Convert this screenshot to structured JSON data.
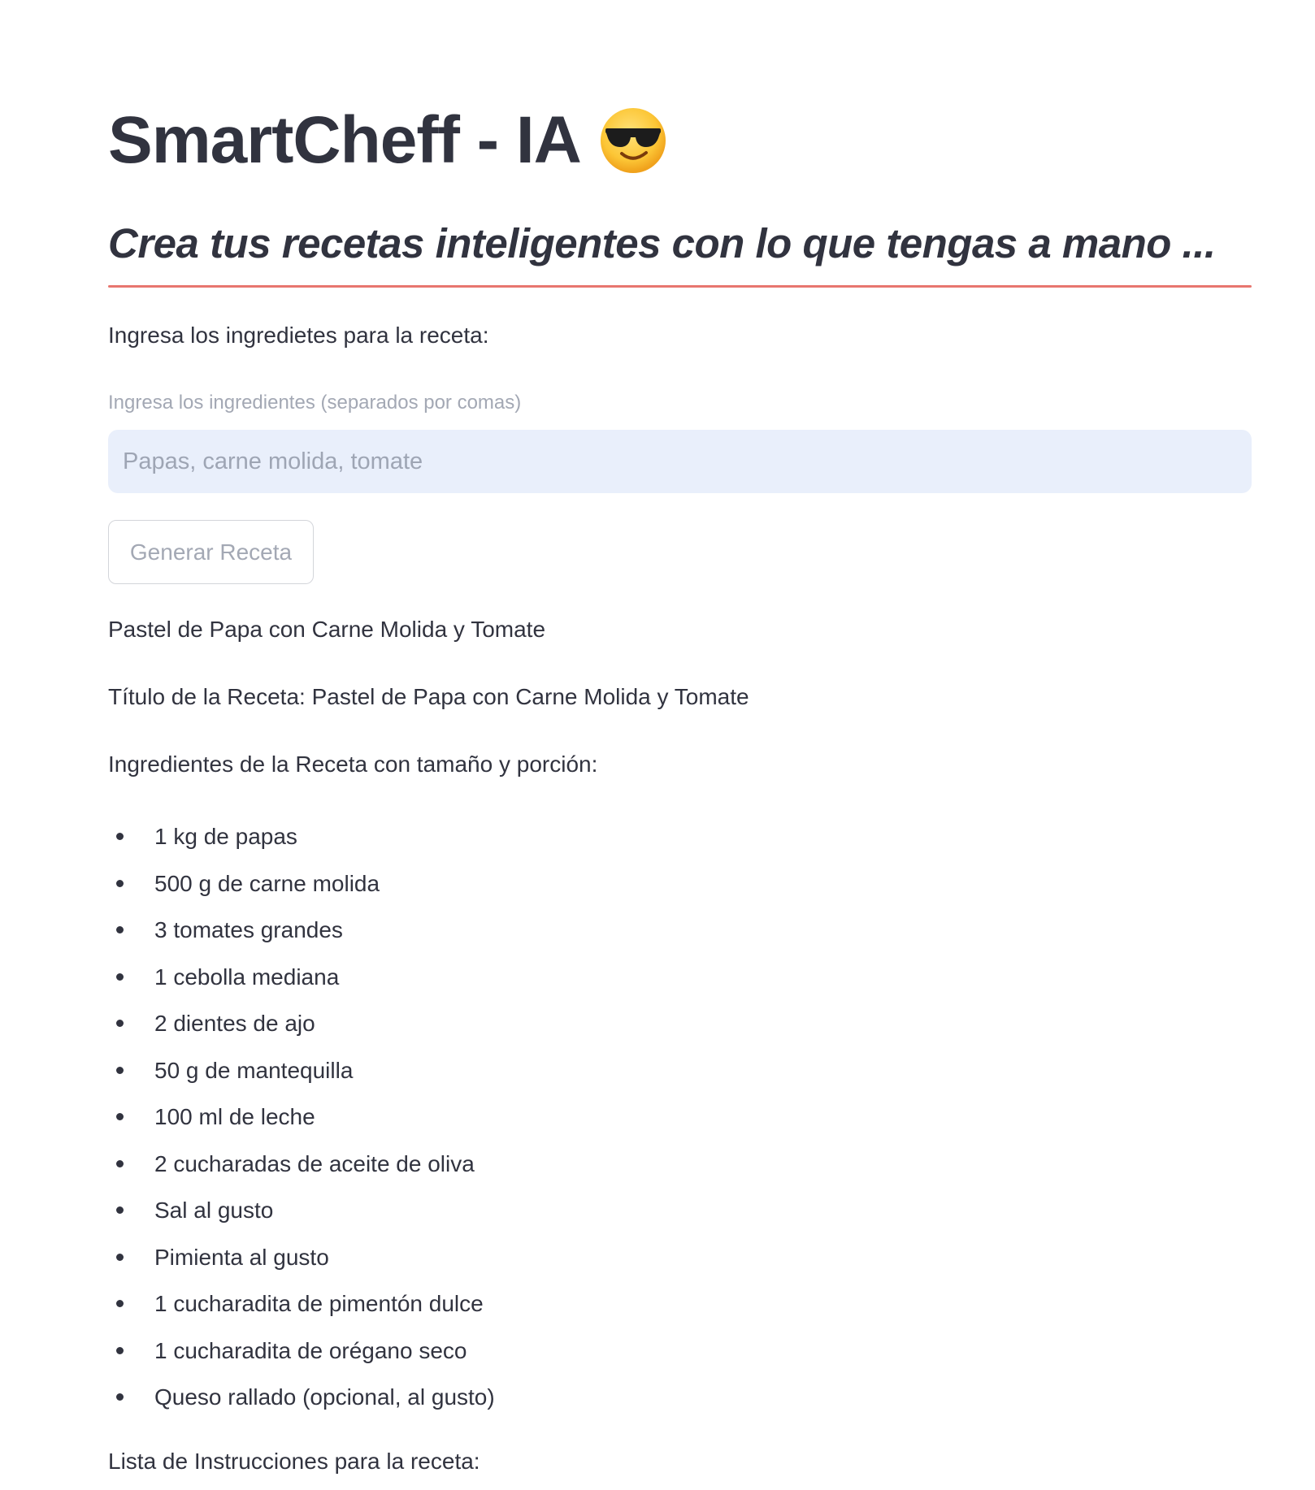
{
  "app": {
    "title": "SmartCheff - IA",
    "title_emoji": "smiling-face-with-sunglasses",
    "subheader": "Crea tus recetas inteligentes con lo que tengas a mano ...",
    "divider_color": "#e8766f"
  },
  "form": {
    "prompt_text": "Ingresa los ingredietes para la receta:",
    "input_label": "Ingresa los ingredientes (separados por comas)",
    "input_placeholder": "Papas, carne molida, tomate",
    "input_value": "",
    "generate_button": "Generar Receta"
  },
  "recipe": {
    "name": "Pastel de Papa con Carne Molida y Tomate",
    "title_line": "Título de la Receta: Pastel de Papa con Carne Molida y Tomate",
    "ingredients_heading": "Ingredientes de la Receta con tamaño y porción:",
    "ingredients": [
      "1 kg de papas",
      "500 g de carne molida",
      "3 tomates grandes",
      "1 cebolla mediana",
      "2 dientes de ajo",
      "50 g de mantequilla",
      "100 ml de leche",
      "2 cucharadas de aceite de oliva",
      "Sal al gusto",
      "Pimienta al gusto",
      "1 cucharadita de pimentón dulce",
      "1 cucharadita de orégano seco",
      "Queso rallado (opcional, al gusto)"
    ],
    "instructions_heading": "Lista de Instrucciones para la receta:"
  }
}
